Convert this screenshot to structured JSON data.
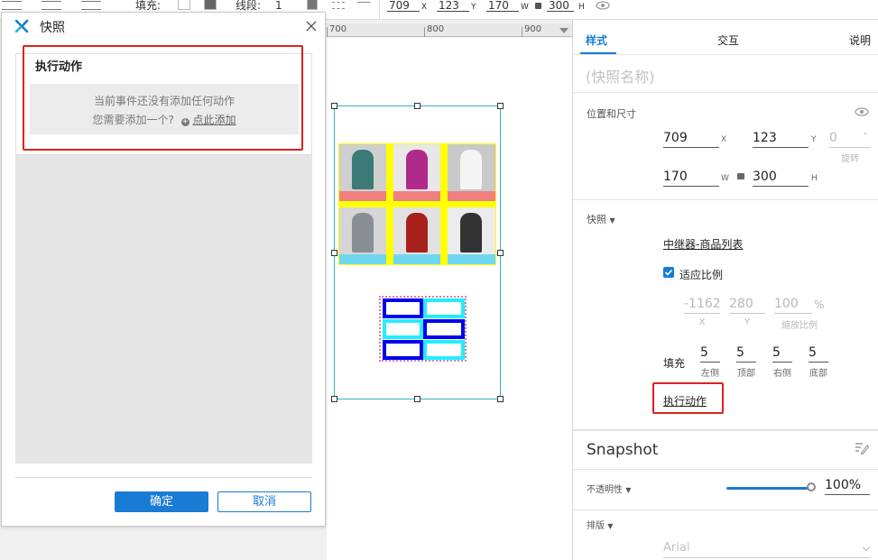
{
  "toolbar": {
    "fill_label": "填充:",
    "stroke_label": "线段:",
    "stroke_value": "1",
    "x_value": "709",
    "x_unit": "X",
    "y_value": "123",
    "y_unit": "Y",
    "w_value": "170",
    "w_unit": "W",
    "h_value": "300",
    "h_unit": "H"
  },
  "ruler": {
    "labels": [
      "700",
      "800",
      "900"
    ]
  },
  "dialog": {
    "title": "快照",
    "section_title": "执行动作",
    "empty_line1": "当前事件还没有添加任何动作",
    "empty_line2": "您需要添加一个?",
    "add_link": "点此添加",
    "ok_button": "确定",
    "cancel_button": "取消"
  },
  "panel": {
    "tabs": [
      "样式",
      "交互",
      "说明"
    ],
    "name_placeholder": "(快照名称)",
    "pos_size_label": "位置和尺寸",
    "x": "709",
    "x_unit": "X",
    "y": "123",
    "y_unit": "Y",
    "rotation": "0",
    "rotation_unit": "°",
    "rotation_label": "旋转",
    "w": "170",
    "w_unit": "W",
    "h": "300",
    "h_unit": "H",
    "snapshot_label": "快照",
    "snapshot_target": "中继器-商品列表",
    "fit_label": "适应比例",
    "fit_checked": true,
    "offset_x": "-1162",
    "offset_x_label": "X",
    "offset_y": "280",
    "offset_y_label": "Y",
    "scale": "100",
    "scale_unit": "%",
    "scale_label": "缩放比例",
    "padding_label": "填充",
    "padding": [
      {
        "value": "5",
        "label": "左侧"
      },
      {
        "value": "5",
        "label": "顶部"
      },
      {
        "value": "5",
        "label": "右侧"
      },
      {
        "value": "5",
        "label": "底部"
      }
    ],
    "action_link": "执行动作",
    "style_title": "Snapshot",
    "opacity_label": "不透明性",
    "opacity_value": "100%",
    "opacity": 1.0,
    "layout_label": "排版",
    "font_value": "Arial"
  },
  "colors": {
    "accent": "#1a7bd5",
    "highlight_red": "#e02020",
    "selection": "#2fb6c0",
    "tile_yellow": "#ffff00",
    "tile_pink": "#f08080",
    "tile_cyan": "#6fd8f0",
    "mini_blue": "#0000ee",
    "mini_cyan": "#22eeff",
    "mini_border": "#cc80b0"
  }
}
